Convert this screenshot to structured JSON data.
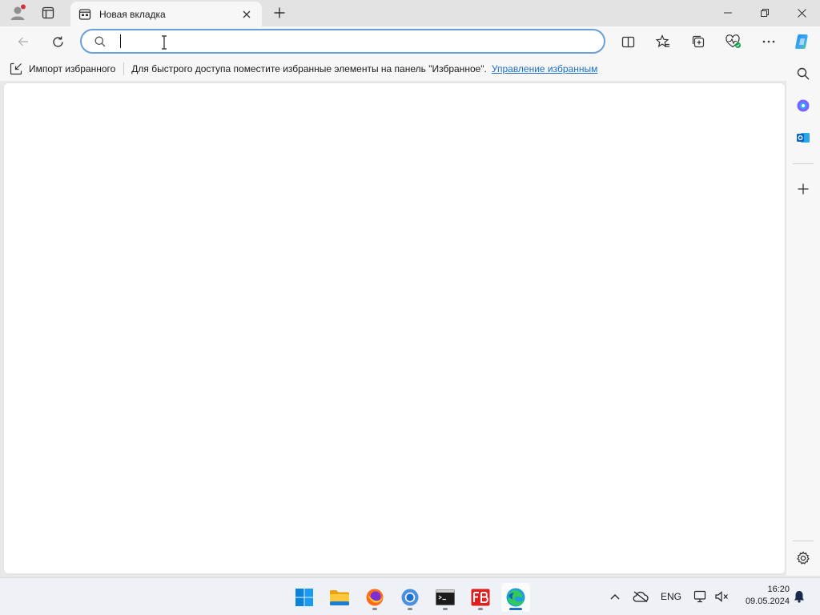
{
  "tab": {
    "title": "Новая вкладка"
  },
  "omnibox": {
    "value": "",
    "placeholder": ""
  },
  "favorites_bar": {
    "import_label": "Импорт избранного",
    "hint": "Для быстрого доступа поместите избранные элементы на панель \"Избранное\".",
    "manage_link": "Управление избранным"
  },
  "taskbar": {
    "language": "ENG",
    "time": "16:20",
    "date": "09.05.2024",
    "apps": [
      "start-icon",
      "file-explorer-icon",
      "firefox-icon",
      "chrome-icon",
      "terminal-icon",
      "fb-app-icon",
      "edge-icon"
    ]
  },
  "colors": {
    "accent": "#1d6fc2",
    "omnibox_border": "#6aa0d8",
    "taskbar_bg": "#eef1f6"
  }
}
